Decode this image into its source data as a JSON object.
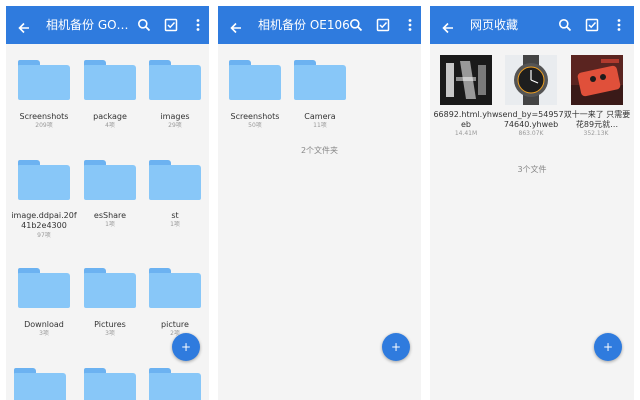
{
  "screens": [
    {
      "title": "相机备份 GO…",
      "folders": [
        {
          "name": "Screenshots",
          "count": "209项"
        },
        {
          "name": "package",
          "count": "4项"
        },
        {
          "name": "images",
          "count": "29项"
        },
        {
          "name": "image.ddpai.20f41b2e4300",
          "count": "97项"
        },
        {
          "name": "esShare",
          "count": "1项"
        },
        {
          "name": "st",
          "count": "1项"
        },
        {
          "name": "Download",
          "count": "3项"
        },
        {
          "name": "Pictures",
          "count": "3项"
        },
        {
          "name": "picture",
          "count": "2项"
        }
      ]
    },
    {
      "title": "相机备份 OE106",
      "folders": [
        {
          "name": "Screenshots",
          "count": "50项"
        },
        {
          "name": "Camera",
          "count": "11项"
        }
      ],
      "summary": "2个文件夹"
    },
    {
      "title": "网页收藏",
      "files": [
        {
          "name": "66892.html.yhweb",
          "size": "14.41M"
        },
        {
          "name": "send_by=5495774640.yhweb",
          "size": "863.07K"
        },
        {
          "name": "双十一来了 只需要花89元就…",
          "size": "352.13K"
        }
      ],
      "summary": "3个文件"
    }
  ],
  "fab_label": "+",
  "icons": [
    "back-arrow-icon",
    "search-icon",
    "checkbox-icon",
    "more-vert-icon",
    "folder-icon"
  ],
  "colors": {
    "appbar": "#2f7bde",
    "folder": "#88c7f8",
    "background": "#f4f4f4"
  }
}
